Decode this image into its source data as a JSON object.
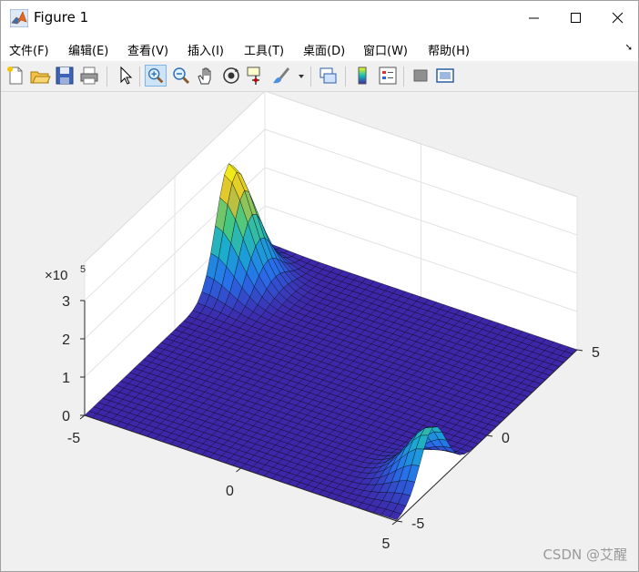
{
  "window": {
    "title": "Figure 1"
  },
  "menu": [
    {
      "label": "文件(F)"
    },
    {
      "label": "编辑(E)"
    },
    {
      "label": "查看(V)"
    },
    {
      "label": "插入(I)"
    },
    {
      "label": "工具(T)"
    },
    {
      "label": "桌面(D)"
    },
    {
      "label": "窗口(W)"
    },
    {
      "label": "帮助(H)"
    }
  ],
  "toolbar": [
    {
      "icon": "new-figure-icon"
    },
    {
      "icon": "open-file-icon"
    },
    {
      "icon": "save-icon"
    },
    {
      "icon": "print-icon"
    },
    {
      "icon": "pointer-icon"
    },
    {
      "icon": "zoom-in-icon"
    },
    {
      "icon": "zoom-out-icon"
    },
    {
      "icon": "pan-hand-icon"
    },
    {
      "icon": "rotate-3d-icon"
    },
    {
      "icon": "data-cursor-icon"
    },
    {
      "icon": "brush-icon"
    },
    {
      "icon": "link-plot-icon"
    },
    {
      "icon": "colorbar-icon"
    },
    {
      "icon": "legend-icon"
    },
    {
      "icon": "hide-plot-tools-icon"
    },
    {
      "icon": "show-plot-tools-icon"
    }
  ],
  "chart_data": {
    "type": "surface",
    "x_ticks": [
      "-5",
      "0",
      "5"
    ],
    "y_ticks": [
      "-5",
      "0",
      "5"
    ],
    "z_ticks": [
      "0",
      "1",
      "2",
      "3"
    ],
    "z_exponent_label": "×10",
    "z_exponent": "5",
    "x_range": [
      -5,
      5
    ],
    "y_range": [
      -5,
      5
    ],
    "z_range": [
      0,
      3
    ],
    "z_scale": 100000,
    "colormap": "parula",
    "grid": true,
    "peaks": [
      {
        "x": -5,
        "y": 3,
        "z": 3.0
      },
      {
        "x": 5,
        "y": -3,
        "z": 1.55
      }
    ],
    "base_level": 0
  },
  "watermark": "CSDN @艾醒"
}
